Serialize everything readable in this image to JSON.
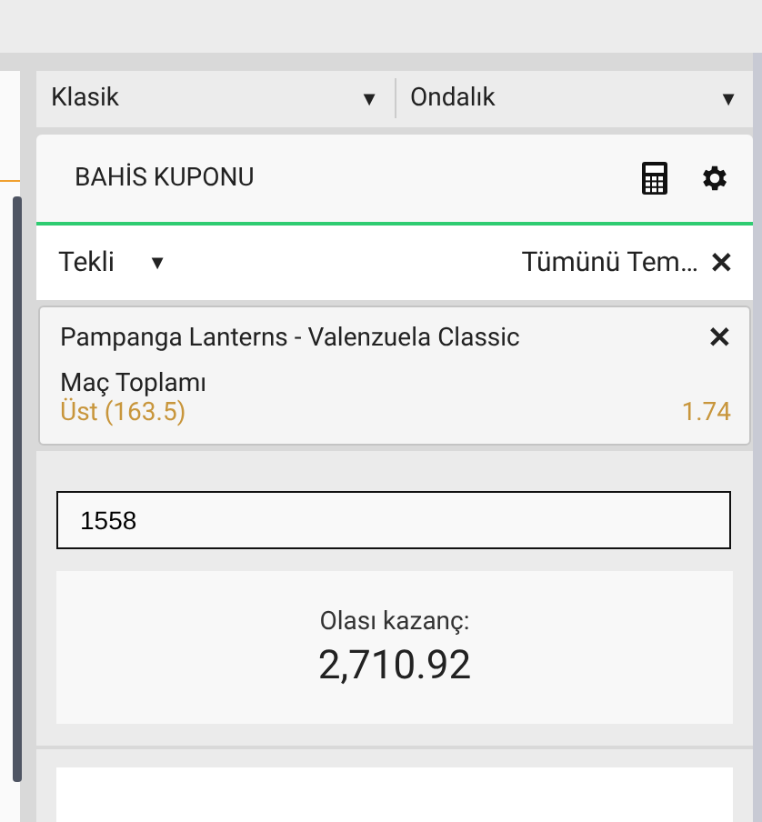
{
  "odds_settings": [
    {
      "label": "Klasik",
      "arrow": "▼"
    },
    {
      "label": "Ondalık",
      "arrow": "▼"
    }
  ],
  "coupon": {
    "title": "BAHİS KUPONU",
    "bet_type": {
      "label": "Tekli",
      "arrow": "▼"
    },
    "clear_all": {
      "label": "Tümünü Tem…",
      "icon": "✕"
    },
    "selections": [
      {
        "event": "Pampanga Lanterns - Valenzuela Classic",
        "remove": "✕",
        "market": "Maç Toplamı",
        "pick": "Üst (163.5)",
        "odds": "1.74"
      }
    ],
    "stake": {
      "value": "1558"
    },
    "potential_win": {
      "label": "Olası kazanç:",
      "amount": "2,710.92"
    }
  }
}
